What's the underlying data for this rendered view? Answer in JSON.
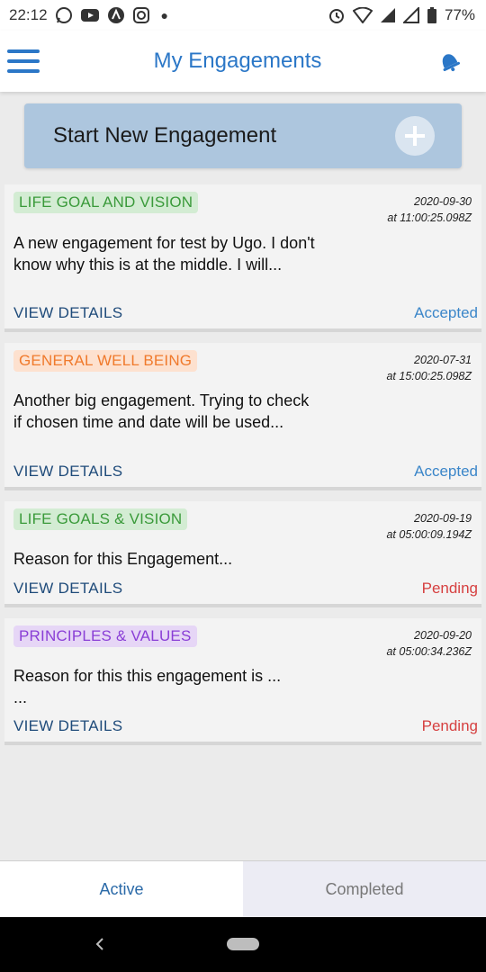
{
  "status_bar": {
    "time": "22:12",
    "battery": "77%",
    "left_icons": [
      "whatsapp-icon",
      "youtube-icon",
      "app-a-icon",
      "instagram-icon"
    ],
    "right_icons": [
      "alarm-icon",
      "wifi-icon",
      "signal-icon",
      "signal-icon",
      "battery-icon"
    ]
  },
  "header": {
    "title": "My Engagements"
  },
  "start_button": {
    "label": "Start New Engagement"
  },
  "engagements": [
    {
      "category": "LIFE GOAL AND VISION",
      "category_color": "green",
      "date": "2020-09-30",
      "time": "at 11:00:25.098Z",
      "description": "A new engagement for test by Ugo. I don't know why this is at the middle. I will...",
      "view_label": "VIEW DETAILS",
      "status": "Accepted"
    },
    {
      "category": "GENERAL WELL BEING",
      "category_color": "orange",
      "date": "2020-07-31",
      "time": "at 15:00:25.098Z",
      "description": "Another big engagement. Trying to check if chosen time and date will be used...",
      "view_label": "VIEW DETAILS",
      "status": "Accepted"
    },
    {
      "category": "LIFE GOALS & VISION",
      "category_color": "green",
      "date": "2020-09-19",
      "time": "at 05:00:09.194Z",
      "description": "Reason for this Engagement...",
      "view_label": "VIEW DETAILS",
      "status": "Pending"
    },
    {
      "category": "PRINCIPLES & VALUES",
      "category_color": "purple",
      "date": "2020-09-20",
      "time": "at 05:00:34.236Z",
      "description": "Reason for this this engagement is ...  ...",
      "view_label": "VIEW DETAILS",
      "status": "Pending"
    }
  ],
  "tabs": {
    "active": "Active",
    "completed": "Completed"
  },
  "colors": {
    "accent": "#2b77c7",
    "accepted": "#3b86c9",
    "pending": "#d64040",
    "start_button_bg": "#adc6de"
  }
}
